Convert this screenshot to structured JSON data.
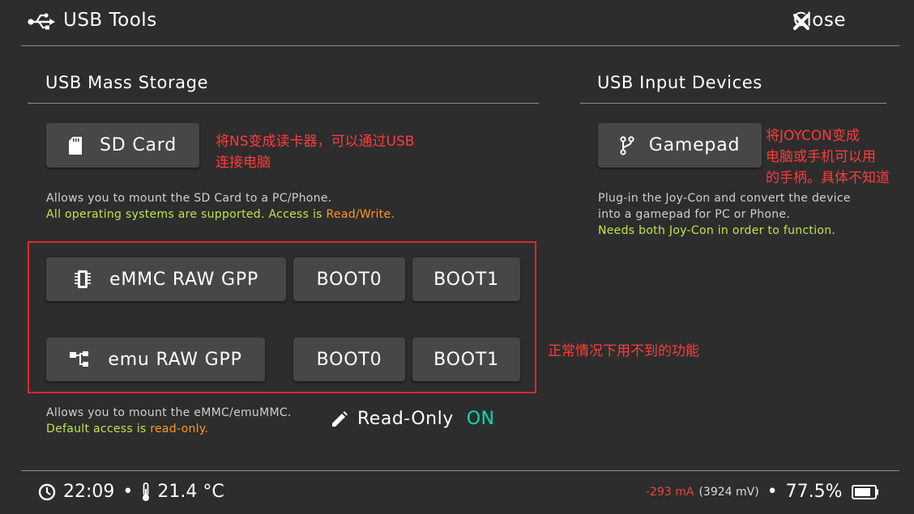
{
  "header": {
    "title": "USB Tools",
    "usb_icon": "usb-icon",
    "close_label": "Close",
    "close_icon": "close-x-icon"
  },
  "mass_storage": {
    "title": "USB Mass Storage",
    "sd_button": {
      "label": "SD Card",
      "icon": "sd-card-icon"
    },
    "sd_desc_line1": "Allows you to mount the SD Card to a PC/Phone.",
    "sd_desc_line2_green": "All operating systems are supported. Access is ",
    "sd_desc_line2_orange": "Read/Write.",
    "emmc_button": {
      "label": "eMMC RAW GPP",
      "icon": "chip-icon"
    },
    "emmc_boot0": "BOOT0",
    "emmc_boot1": "BOOT1",
    "emu_button": {
      "label": "emu RAW GPP",
      "icon": "network-nodes-icon"
    },
    "emu_boot0": "BOOT0",
    "emu_boot1": "BOOT1",
    "raw_desc_line1": "Allows you to mount the eMMC/emuMMC.",
    "raw_desc_line2_green": "Default access is ",
    "raw_desc_line2_orange": "read-only.",
    "readonly_label": "Read-Only",
    "readonly_value": "ON",
    "readonly_icon": "pencil-icon"
  },
  "input_devices": {
    "title": "USB Input Devices",
    "gamepad_button": {
      "label": "Gamepad",
      "icon": "fork-icon"
    },
    "desc_line1": "Plug-in the Joy-Con and convert the device",
    "desc_line2": "into a gamepad for PC or Phone.",
    "desc_line3_green": "Needs both Joy-Con in order to function."
  },
  "annotations": {
    "sd_line1": "将NS变成读卡器，可以通过USB",
    "sd_line2": "连接电脑",
    "gamepad_line1": "将JOYCON变成",
    "gamepad_line2": "电脑或手机可以用",
    "gamepad_line3": "的手柄。具体不知道",
    "raw_note": "正常情况下用不到的功能"
  },
  "status_bar": {
    "time": "22:09",
    "separator": "•",
    "temperature": "21.4 °C",
    "current": "-293 mA",
    "voltage": "(3924 mV)",
    "battery_percent": "77.5%",
    "clock_icon": "clock-icon",
    "thermometer_icon": "thermometer-icon",
    "battery_icon": "battery-icon"
  },
  "colors": {
    "background": "#2d2d2d",
    "button": "#474747",
    "green_text": "#c2e34a",
    "orange_text": "#ff9a1a",
    "on_text": "#00e0b0",
    "annotation_red": "#ff3b3b",
    "current_red": "#e8473c"
  }
}
